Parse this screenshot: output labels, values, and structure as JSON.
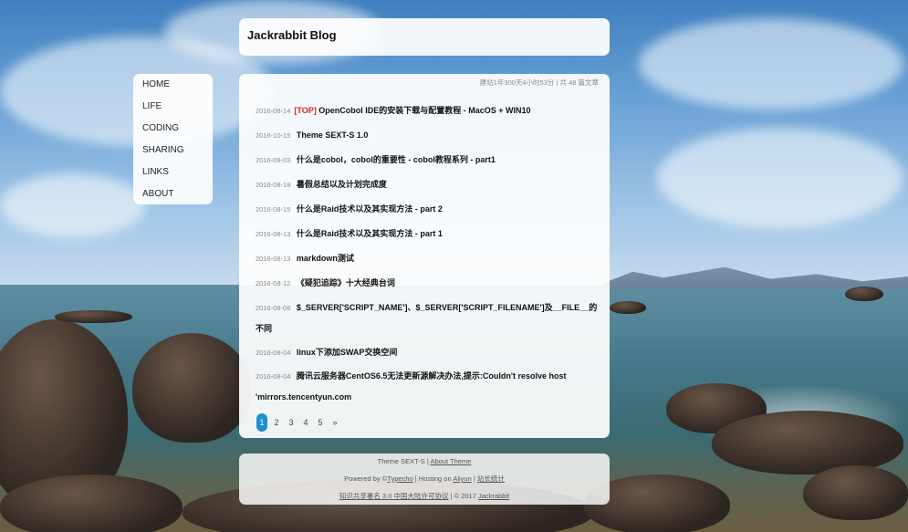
{
  "site": {
    "title": "Jackrabbit Blog"
  },
  "nav": {
    "items": [
      "HOME",
      "LIFE",
      "CODING",
      "SHARING",
      "LINKS",
      "ABOUT"
    ]
  },
  "stats": "建站1年300天4小时53分 | 共 48 篇文章",
  "posts": [
    {
      "date": "2016-08-14",
      "tag": "[TOP]",
      "title": "OpenCobol IDE的安装下载与配置教程 - MacOS + WIN10"
    },
    {
      "date": "2016-10-15",
      "tag": "",
      "title": "Theme SEXT-S 1.0"
    },
    {
      "date": "2016-09-03",
      "tag": "",
      "title": "什么是cobol，cobol的重要性 - cobol教程系列 - part1"
    },
    {
      "date": "2016-08-18",
      "tag": "",
      "title": "暑假总结以及计划完成度"
    },
    {
      "date": "2016-08-15",
      "tag": "",
      "title": "什么是Raid技术以及其实现方法 - part 2"
    },
    {
      "date": "2016-08-13",
      "tag": "",
      "title": "什么是Raid技术以及其实现方法 - part 1"
    },
    {
      "date": "2016-08-13",
      "tag": "",
      "title": "markdown测试"
    },
    {
      "date": "2016-08-12",
      "tag": "",
      "title": "《疑犯追踪》十大经典台词"
    },
    {
      "date": "2016-08-06",
      "tag": "",
      "title": "$_SERVER['SCRIPT_NAME']、$_SERVER['SCRIPT_FILENAME']及__FILE__的不同"
    },
    {
      "date": "2016-08-04",
      "tag": "",
      "title": "linux下添加SWAP交换空间"
    },
    {
      "date": "2016-08-04",
      "tag": "",
      "title": "腾讯云服务器CentOS6.5无法更新源解决办法,提示:Couldn't resolve host 'mirrors.tencentyun.com"
    }
  ],
  "pagination": {
    "pages": [
      "1",
      "2",
      "3",
      "4",
      "5",
      "»"
    ],
    "current": "1"
  },
  "footer": {
    "line1_prefix": "Theme SEXT-S",
    "line1_sep": " | ",
    "line1_link": "About Theme",
    "line2_a": "Powered by ©",
    "line2_typecho": "Typecho",
    "line2_b": " | Hosting on ",
    "line2_aliyun": "Aliyun",
    "line2_c": " | ",
    "line2_stats": "站长统计",
    "line3_license": "知识共享署名 3.0 中国大陆许可协议",
    "line3_mid": " | © 2017 ",
    "line3_author": "Jackrabbit"
  },
  "colors": {
    "accent": "#1e8fcf",
    "top_tag": "#dd2222"
  }
}
